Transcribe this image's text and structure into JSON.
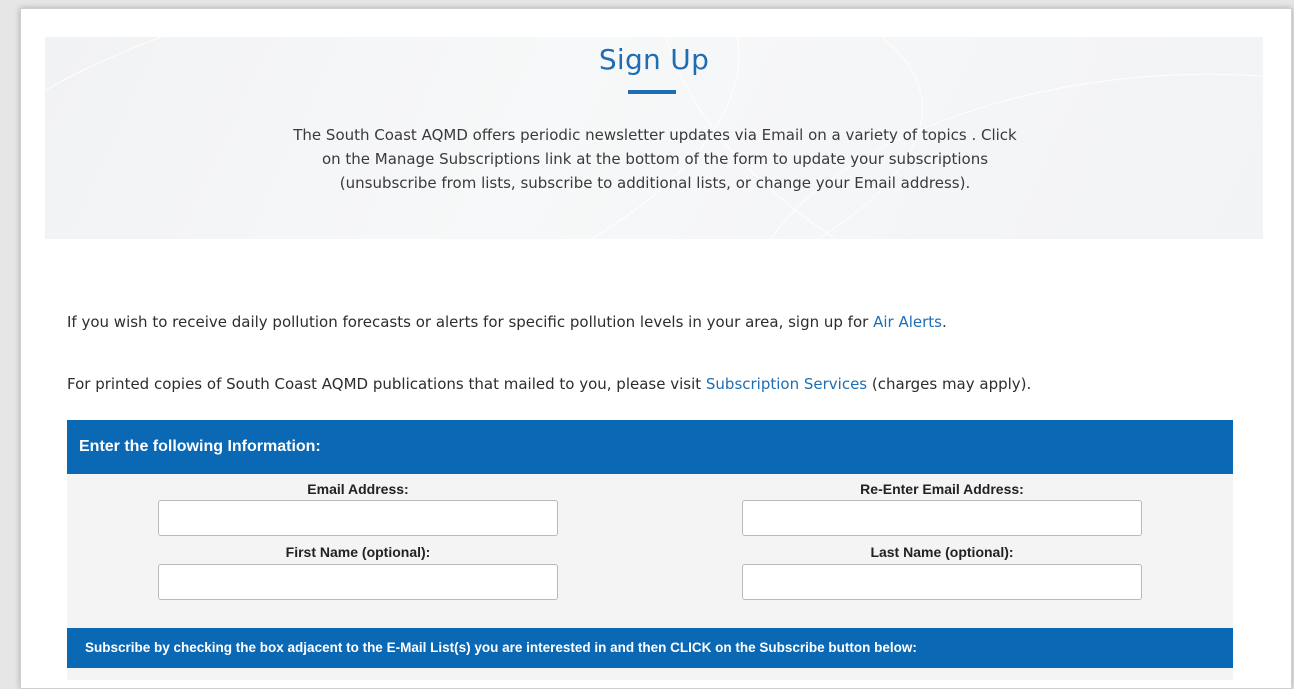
{
  "hero": {
    "title": "Sign Up",
    "description_lines": [
      "The South Coast AQMD offers periodic newsletter updates via Email on a variety of topics . Click",
      "on the Manage Subscriptions link at the bottom of the form to update your subscriptions",
      "(unsubscribe from lists, subscribe to additional lists, or change your Email address)."
    ]
  },
  "info": {
    "air_alerts_prefix": "If you wish to receive daily pollution forecasts or alerts for specific pollution levels in your area, sign up for ",
    "air_alerts_link": "Air Alerts",
    "air_alerts_suffix": ".",
    "printed_prefix": "For printed copies of South Coast AQMD publications that mailed to you, please visit ",
    "printed_link": "Subscription Services",
    "printed_suffix": " (charges may apply)."
  },
  "form": {
    "header": "Enter the following Information:",
    "email_label": "Email Address:",
    "email_value": "",
    "reenter_email_label": "Re-Enter Email Address:",
    "reenter_email_value": "",
    "first_name_label": "First Name (optional):",
    "first_name_value": "",
    "last_name_label": "Last Name (optional):",
    "last_name_value": "",
    "subscribe_instructions": "Subscribe by checking the box adjacent to the E-Mail List(s) you are interested in and then CLICK on the Subscribe button below:"
  },
  "colors": {
    "brand_blue": "#0b68b5",
    "link_blue": "#1f6db4"
  }
}
